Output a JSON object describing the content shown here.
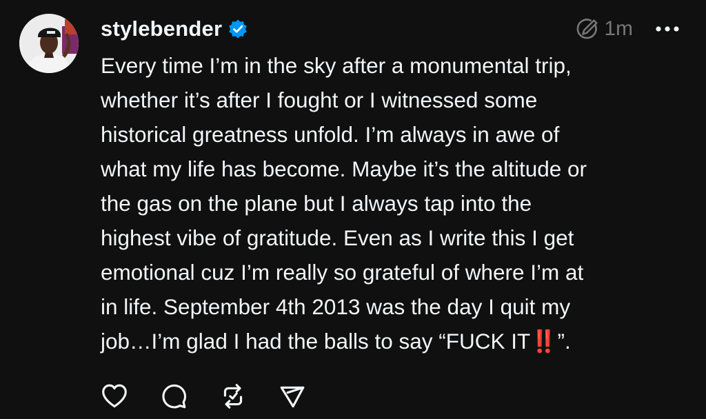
{
  "post": {
    "author": {
      "username": "stylebender",
      "verified": true,
      "avatar_icon": "profile-photo",
      "verified_icon": "verified-badge-icon"
    },
    "meta": {
      "edited_icon": "edited-icon",
      "timestamp": "1m",
      "more_icon": "more-horizontal-icon"
    },
    "text_lines": [
      "Every time I’m in the sky after a monumental trip,",
      "whether it’s after I fought or I witnessed some",
      "historical greatness unfold. I’m always in awe of",
      "what my life has become. Maybe it’s the altitude or",
      "the gas on the plane but I always tap into the",
      "highest vibe of gratitude. Even as I write this I get",
      "emotional cuz I’m really so grateful of where I’m at",
      "in life. September 4th 2013 was the day I quit my"
    ],
    "last_line": {
      "before": "job…I’m glad I had the balls to say “FUCK IT",
      "emoji": "‼️",
      "after": "”."
    },
    "actions": [
      {
        "name": "like",
        "icon": "heart-icon"
      },
      {
        "name": "reply",
        "icon": "comment-icon"
      },
      {
        "name": "repost",
        "icon": "repost-icon"
      },
      {
        "name": "share",
        "icon": "send-icon"
      }
    ]
  },
  "colors": {
    "background": "#101010",
    "text": "#f3f5f7",
    "muted": "#777777",
    "verified_blue": "#0095f6",
    "emoji_red": "#e0201e"
  }
}
